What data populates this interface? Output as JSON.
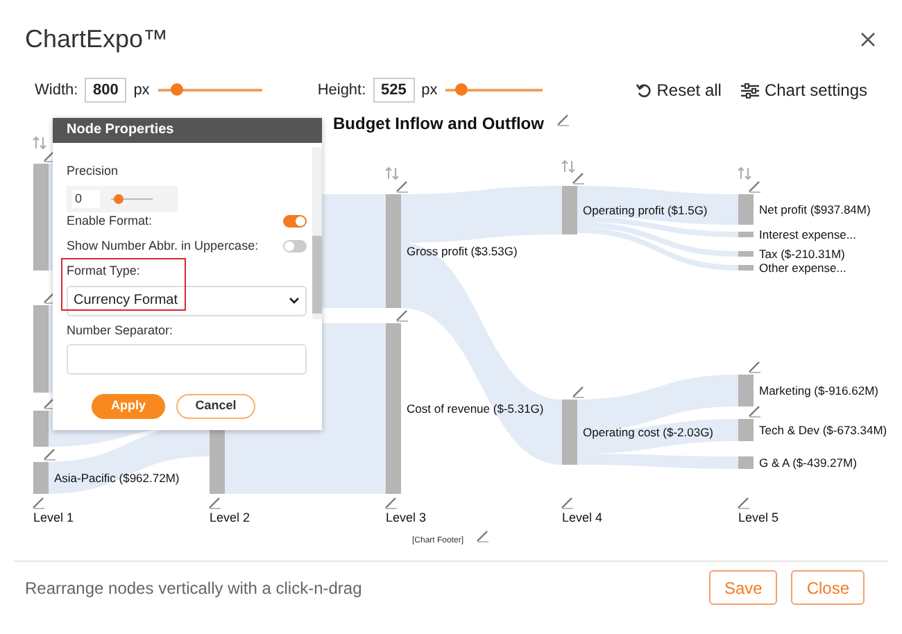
{
  "window": {
    "title": "ChartExpo™"
  },
  "toolbar": {
    "width": {
      "label": "Width:",
      "value": "800",
      "unit": "px",
      "level": 0.18
    },
    "height": {
      "label": "Height:",
      "value": "525",
      "unit": "px",
      "level": 0.15
    },
    "reset": "Reset all",
    "settings": "Chart settings"
  },
  "chart": {
    "title": "Budget Inflow and Outflow",
    "nodes": [
      {
        "label": "Asia-Pacific ($962.72M)"
      },
      {
        "label": "Gross profit ($3.53G)"
      },
      {
        "label": "Cost of revenue ($-5.31G)"
      },
      {
        "label": "Operating profit ($1.5G)"
      },
      {
        "label": "Operating cost ($-2.03G)"
      },
      {
        "label": "Net profit ($937.84M)"
      },
      {
        "label": "Interest expense..."
      },
      {
        "label": "Tax ($-210.31M)"
      },
      {
        "label": "Other expense..."
      },
      {
        "label": "Marketing ($-916.62M)"
      },
      {
        "label": "Tech & Dev ($-673.34M)"
      },
      {
        "label": "G & A ($-439.27M)"
      }
    ],
    "levels": [
      "Level 1",
      "Level 2",
      "Level 3",
      "Level 4",
      "Level 5"
    ],
    "footer": "[Chart Footer]"
  },
  "popup": {
    "title": "Node Properties",
    "precision": {
      "label": "Precision",
      "value": "0",
      "level": 0.05
    },
    "toggles": [
      {
        "label": "Enable Format:",
        "on": true
      },
      {
        "label": "Show Number Abbr. in Uppercase:",
        "on": false
      }
    ],
    "format_type": {
      "label": "Format Type:",
      "value": "Currency Format",
      "highlighted": true
    },
    "number_separator": {
      "label": "Number Separator:"
    },
    "buttons": [
      {
        "label": "Apply",
        "kind": "primary"
      },
      {
        "label": "Cancel",
        "kind": "secondary"
      }
    ]
  },
  "status_bar": {
    "hint": "Rearrange nodes vertically with a click-n-drag",
    "buttons": [
      "Save",
      "Close"
    ]
  }
}
